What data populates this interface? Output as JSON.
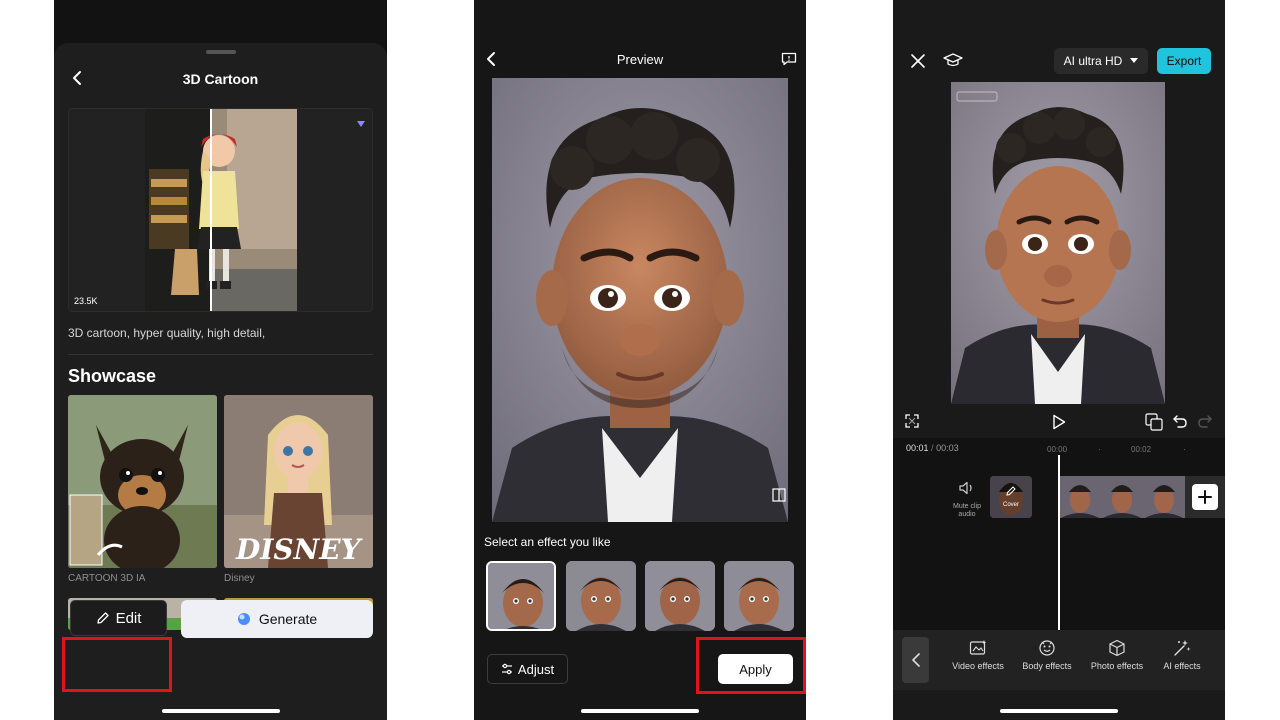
{
  "panel1": {
    "title": "3D Cartoon",
    "view_count": "23.5K",
    "prompt": "3D cartoon, hyper quality, high detail,",
    "section_title": "Showcase",
    "showcase": [
      {
        "label": "CARTOON 3D IA"
      },
      {
        "label": "Disney",
        "overlay": "DISNEY"
      }
    ],
    "edit_label": "Edit",
    "generate_label": "Generate",
    "colors": {
      "highlight": "#e0141e"
    }
  },
  "panel2": {
    "title": "Preview",
    "select_prompt": "Select an effect you like",
    "adjust_label": "Adjust",
    "apply_label": "Apply",
    "thumbnail_count": 4,
    "selected_index": 0
  },
  "panel3": {
    "quality_label": "AI ultra HD",
    "export_label": "Export",
    "current_time": "00:01",
    "total_time": "00:03",
    "ruler_labels": [
      "00:00",
      "00:02"
    ],
    "mute_label": "Mute clip audio",
    "cover_label": "Cover",
    "tools": [
      {
        "label": "Video effects",
        "icon": "video-effects-icon"
      },
      {
        "label": "Body effects",
        "icon": "body-effects-icon"
      },
      {
        "label": "Photo effects",
        "icon": "photo-effects-icon"
      },
      {
        "label": "AI effects",
        "icon": "ai-effects-icon"
      }
    ],
    "colors": {
      "accent": "#20c4dd"
    }
  }
}
